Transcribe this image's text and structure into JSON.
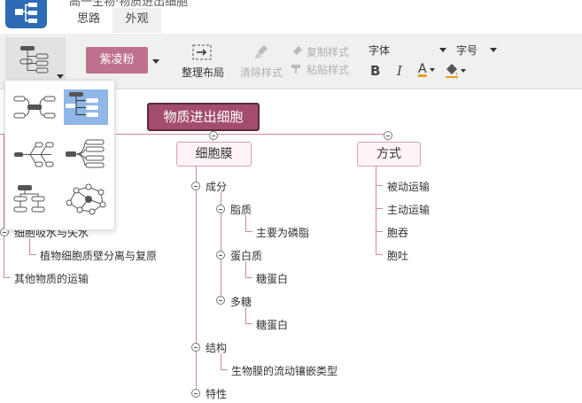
{
  "app": {
    "title": "高一生物·物质进出细胞",
    "tabs": [
      {
        "label": "思路",
        "active": false
      },
      {
        "label": "外观",
        "active": true
      }
    ]
  },
  "toolbar": {
    "theme_label": "紫凌粉",
    "arrange_label": "整理布局",
    "clear_style_label": "清除样式",
    "copy_style_label": "复制样式",
    "paste_style_label": "粘贴样式",
    "font_label": "字体",
    "size_label": "字号",
    "bold_label": "B",
    "italic_label": "I",
    "font_color_label": "A",
    "colors": {
      "theme": "#c0708f",
      "node_border": "#d9a0b2",
      "root_fill": "#a34d6e",
      "accent_blue": "#2d6cb5"
    }
  },
  "layout_popup": {
    "options": [
      {
        "name": "mind-map-layout",
        "selected": false
      },
      {
        "name": "org-tree-layout",
        "selected": true
      },
      {
        "name": "fishbone-left-layout",
        "selected": false
      },
      {
        "name": "fishbone-right-layout",
        "selected": false
      },
      {
        "name": "org-chart-layout",
        "selected": false
      },
      {
        "name": "free-graph-layout",
        "selected": false
      }
    ]
  },
  "mindmap": {
    "root": "物质进出细胞",
    "left_partial": {
      "item1": "细胞吸水与失水",
      "item1_child": "植物细胞质壁分离与复原",
      "item2": "其他物质的运输"
    },
    "membrane": {
      "label": "细胞膜",
      "composition": {
        "label": "成分",
        "lipid": "脂质",
        "lipid_child": "主要为磷脂",
        "protein": "蛋白质",
        "protein_child": "糖蛋白",
        "sugar": "多糖",
        "sugar_child": "糖蛋白"
      },
      "structure": {
        "label": "结构",
        "child": "生物膜的流动镶嵌类型"
      },
      "property": {
        "label": "特性"
      }
    },
    "method": {
      "label": "方式",
      "items": [
        "被动运输",
        "主动运输",
        "胞吞",
        "胞吐"
      ]
    }
  }
}
